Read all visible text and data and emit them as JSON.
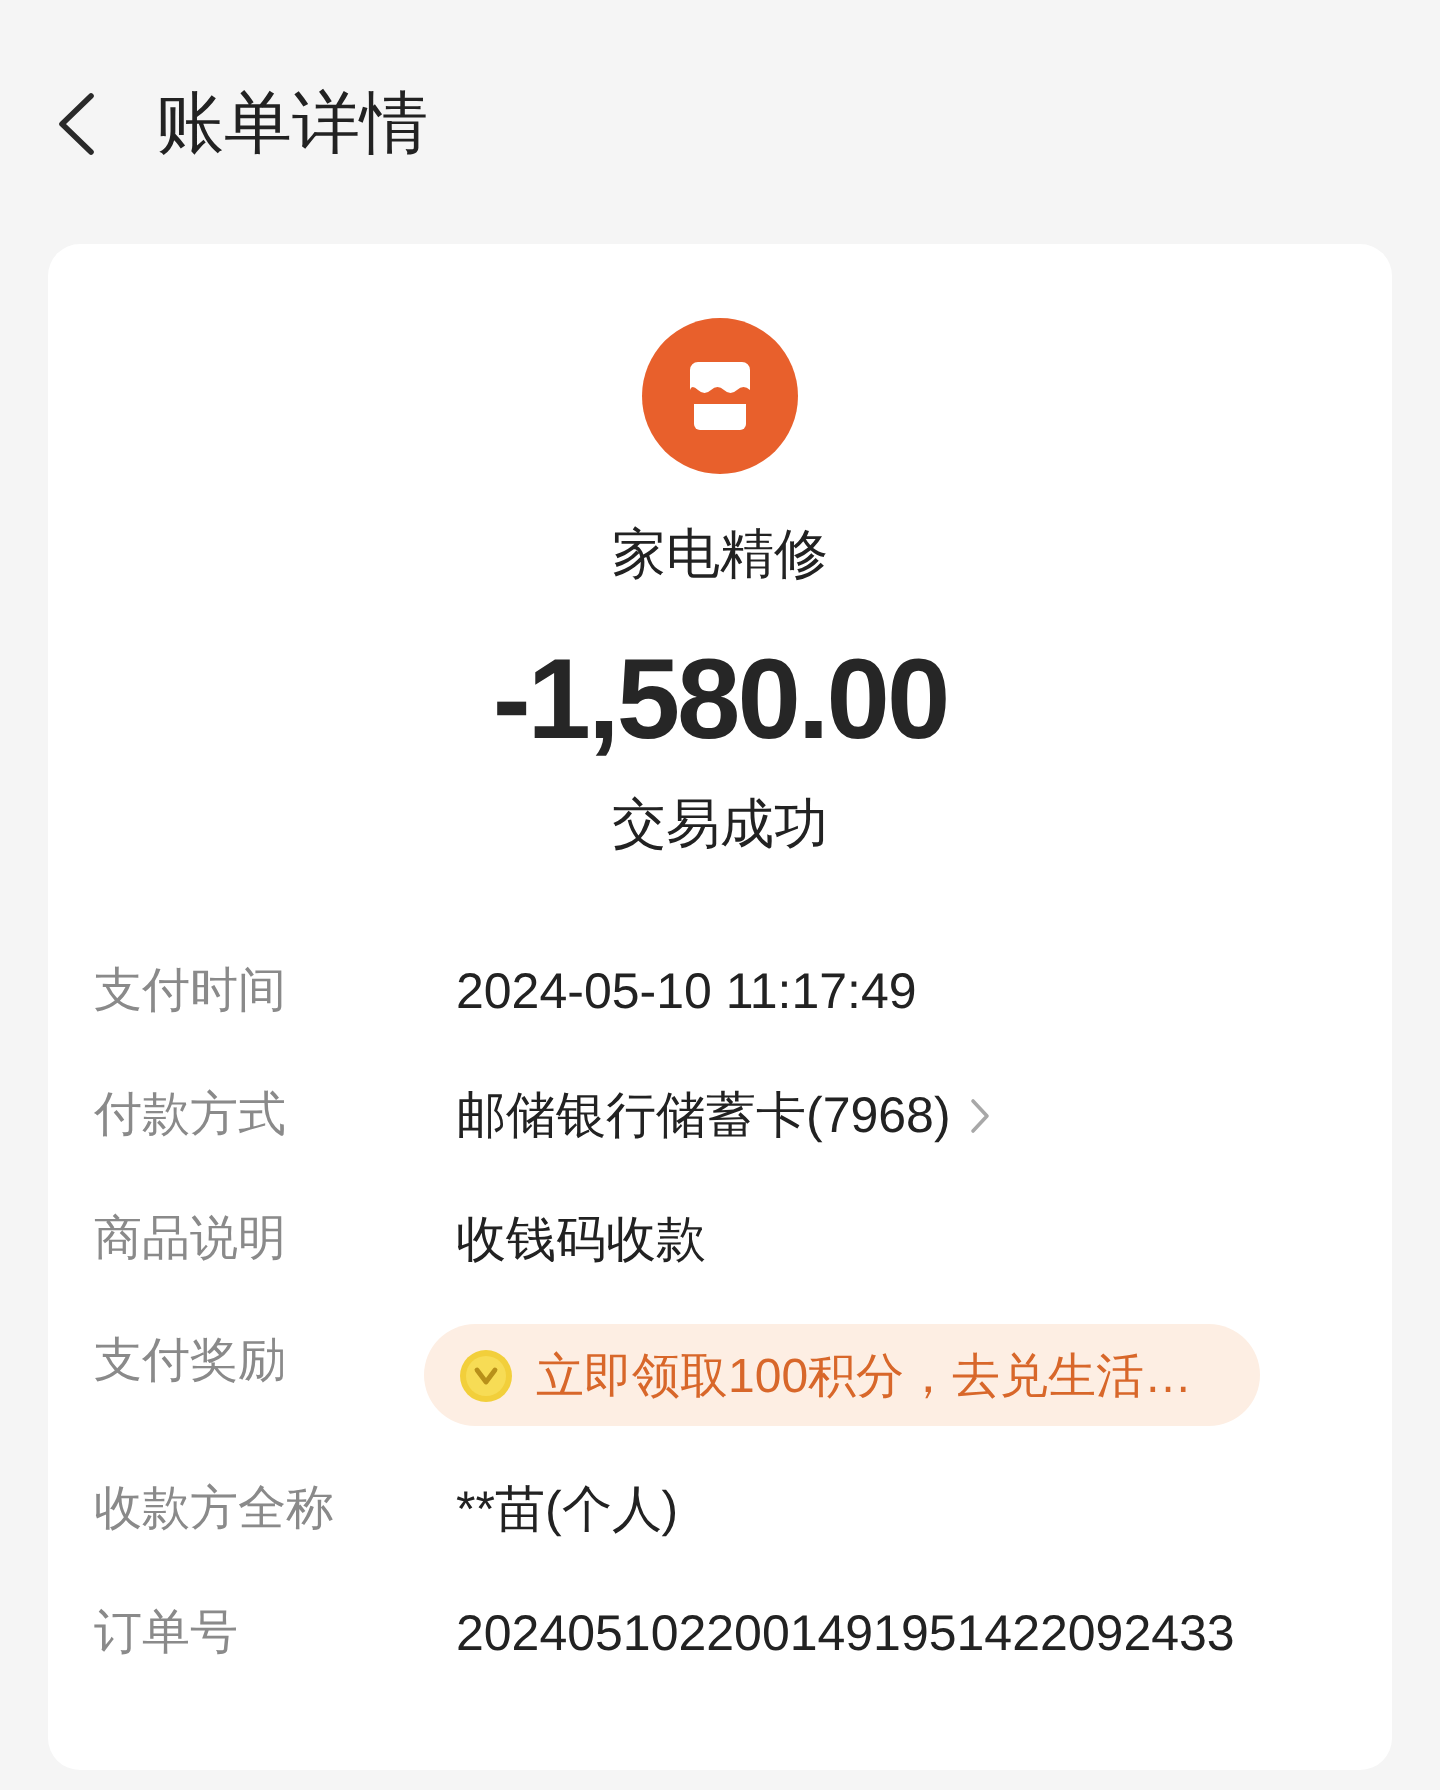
{
  "header": {
    "title": "账单详情"
  },
  "merchant": {
    "name": "家电精修",
    "amount": "-1,580.00",
    "status": "交易成功"
  },
  "details": [
    {
      "kind": "text",
      "label": "支付时间",
      "value": "2024-05-10 11:17:49"
    },
    {
      "kind": "link",
      "label": "付款方式",
      "value": "邮储银行储蓄卡(7968)"
    },
    {
      "kind": "text",
      "label": "商品说明",
      "value": "收钱码收款"
    },
    {
      "kind": "reward",
      "label": "支付奖励",
      "value": "立即领取100积分，去兑生活…"
    },
    {
      "kind": "text",
      "label": "收款方全称",
      "value": "**苗(个人)"
    },
    {
      "kind": "text",
      "label": "订单号",
      "value": "2024051022001491951422092433"
    }
  ]
}
